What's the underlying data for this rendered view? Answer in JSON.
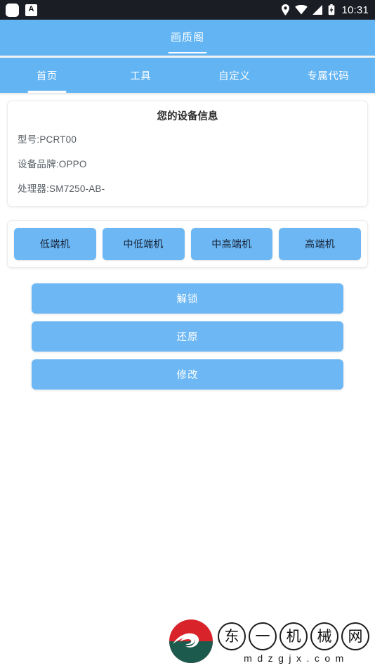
{
  "status_bar": {
    "left_icons": [
      "app-square-icon",
      "keyboard-a-icon"
    ],
    "a_badge": "A",
    "right_icons": [
      "location-pin-icon",
      "wifi-icon",
      "signal-icon",
      "battery-charging-icon"
    ],
    "time": "10:31"
  },
  "header": {
    "title": "画质阁"
  },
  "tabs": [
    {
      "label": "首页",
      "active": true
    },
    {
      "label": "工具",
      "active": false
    },
    {
      "label": "自定义",
      "active": false
    },
    {
      "label": "专属代码",
      "active": false
    }
  ],
  "device_card": {
    "title": "您的设备信息",
    "lines": [
      "型号:PCRT00",
      "设备品牌:OPPO",
      "处理器:SM7250-AB-"
    ]
  },
  "tier_buttons": [
    {
      "label": "低端机"
    },
    {
      "label": "中低端机"
    },
    {
      "label": "中高端机"
    },
    {
      "label": "高端机"
    }
  ],
  "action_buttons": [
    {
      "label": "解锁"
    },
    {
      "label": "还原"
    },
    {
      "label": "修改"
    }
  ],
  "watermark": {
    "chars": [
      "东",
      "一",
      "机",
      "械",
      "网"
    ],
    "domain": "mdzgjx.com"
  },
  "colors": {
    "brand_blue": "#62b4f3",
    "button_blue": "#6db8f4",
    "status_bar": "#1b1d24",
    "logo_red": "#d8232a",
    "logo_green": "#1b5a4d"
  }
}
